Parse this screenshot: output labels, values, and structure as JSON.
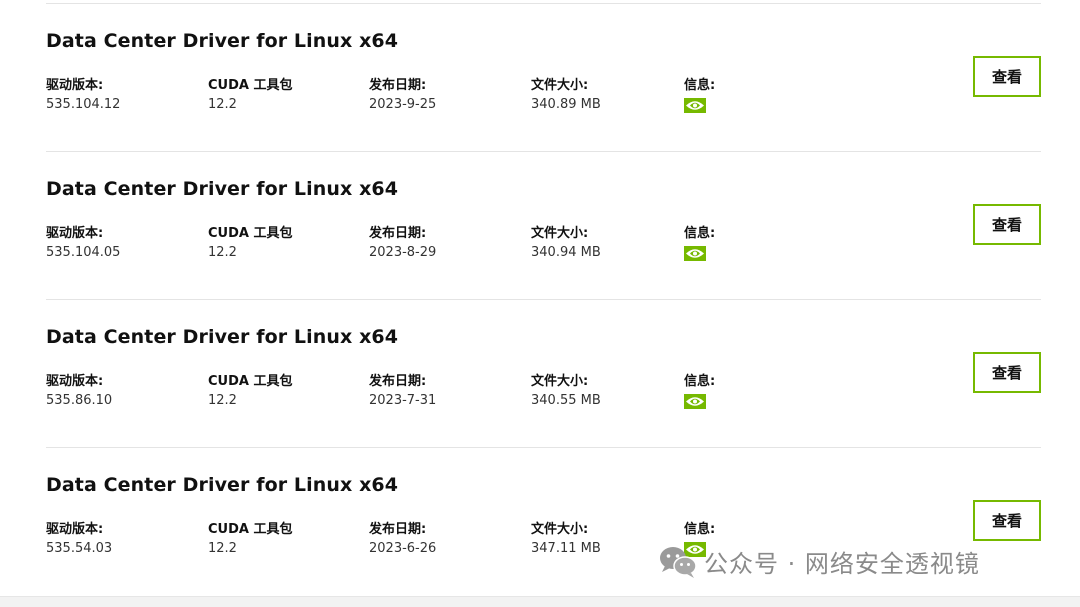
{
  "labels": {
    "driver_version": "驱动版本:",
    "cuda_toolkit": "CUDA 工具包",
    "release_date": "发布日期:",
    "file_size": "文件大小:",
    "info": "信息:",
    "view_button": "查看"
  },
  "drivers": [
    {
      "title": "Data Center Driver for Linux x64",
      "version": "535.104.12",
      "cuda": "12.2",
      "date": "2023-9-25",
      "size": "340.89 MB"
    },
    {
      "title": "Data Center Driver for Linux x64",
      "version": "535.104.05",
      "cuda": "12.2",
      "date": "2023-8-29",
      "size": "340.94 MB"
    },
    {
      "title": "Data Center Driver for Linux x64",
      "version": "535.86.10",
      "cuda": "12.2",
      "date": "2023-7-31",
      "size": "340.55 MB"
    },
    {
      "title": "Data Center Driver for Linux x64",
      "version": "535.54.03",
      "cuda": "12.2",
      "date": "2023-6-26",
      "size": "347.11 MB"
    }
  ],
  "watermark": {
    "text": "公众号 · 网络安全透视镜",
    "icon": "wechat-icon"
  },
  "colors": {
    "accent": "#76b900",
    "divider": "#e4e4e4"
  }
}
